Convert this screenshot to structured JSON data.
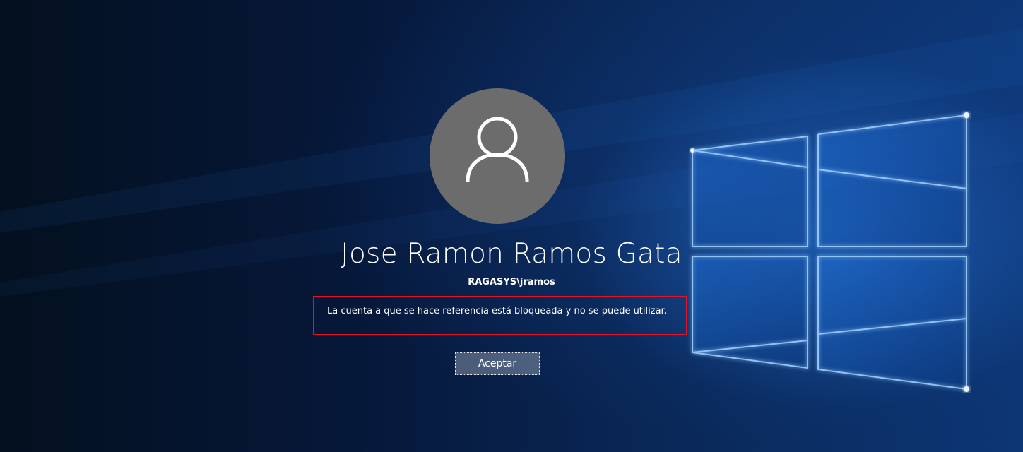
{
  "user": {
    "name": "Jose Ramon Ramos Gata",
    "account": "RAGASYS\\jramos"
  },
  "message": {
    "text": "La cuenta a que se hace referencia está bloqueada y no se puede utilizar."
  },
  "actions": {
    "ok_label": "Aceptar"
  },
  "icons": {
    "avatar": "user-icon",
    "background": "windows-logo"
  },
  "colors": {
    "highlight_border": "#e81123",
    "avatar_bg": "#6c6c6c",
    "text": "#ffffff"
  }
}
